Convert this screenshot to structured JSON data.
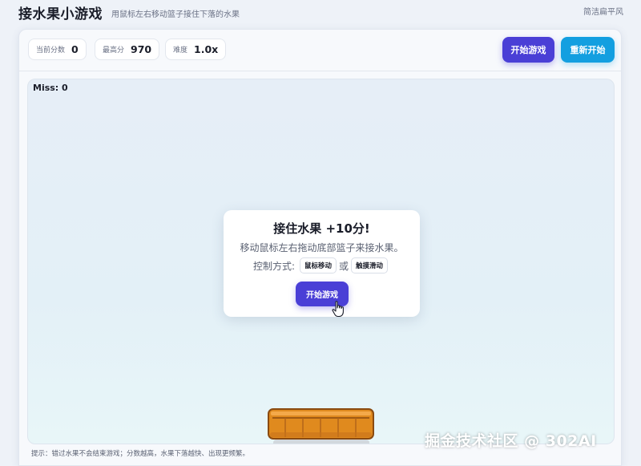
{
  "header": {
    "title": "接水果小游戏",
    "subtitle": "用鼠标左右移动篮子接住下落的水果",
    "style_tag": "简洁扁平风"
  },
  "stats": {
    "current_score_label": "当前分数",
    "current_score": "0",
    "high_score_label": "最高分",
    "high_score": "970",
    "difficulty_label": "难度",
    "difficulty": "1.0x"
  },
  "toolbar": {
    "start_label": "开始游戏",
    "restart_label": "重新开始"
  },
  "game": {
    "miss_text": "Miss: 0"
  },
  "overlay": {
    "title": "接住水果 +10分!",
    "description": "移动鼠标左右拖动底部篮子来接水果。",
    "controls_label": "控制方式:",
    "control_mouse": "鼠标移动",
    "control_or": "或",
    "control_touch": "触摸滑动",
    "start_label": "开始游戏"
  },
  "footer": {
    "hint": "提示：错过水果不会结束游戏；分数越高，水果下落越快、出现更频繁。"
  },
  "watermark": "掘金技术社区 @ 302AI",
  "colors": {
    "primary": "#4a3fd6",
    "secondary": "#139fe0",
    "basket": "#e08a1e"
  }
}
